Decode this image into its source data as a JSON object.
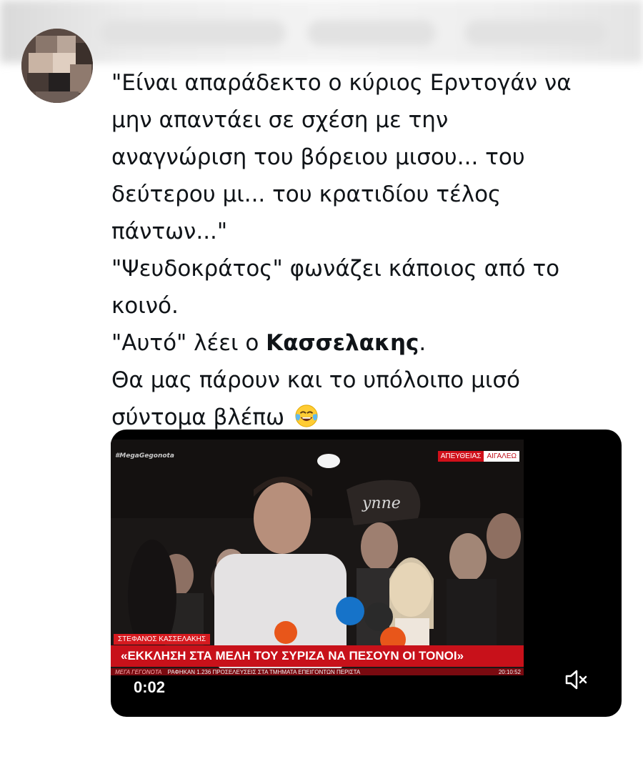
{
  "tweet": {
    "lines": [
      "\"Είναι απαράδεκτο ο κύριος Ερντογάν να",
      "μην απαντάει σε σχέση με την",
      "αναγνώριση του βόρειου μισου... του",
      "δεύτερου μι... του κρατιδίου τέλος",
      "πάντων...\"",
      "\"Ψευδοκράτος\" φωνάζει κάποιος από το",
      "κοινό."
    ],
    "line8_prefix": "\"Αυτό\" λέει ο ",
    "line8_bold": "Κασσελακης",
    "line8_suffix": ".",
    "line9": "Θα μας πάρουν και το υπόλοιπο μισό",
    "line10": "σύντομα βλέπω",
    "emoji": "face-with-tears-of-joy-icon"
  },
  "video": {
    "channel_logo": "#MegaGegonota",
    "live_label": "ΑΠΕΥΘΕΙΑΣ",
    "live_location": "ΑΙΓΑΛΕΩ",
    "name_strip": "ΣΤΕΦΑΝΟΣ ΚΑΣΣΕΛΑΚΗΣ",
    "headline": "«ΕΚΚΛΗΣΗ ΣΤΑ ΜΕΛΗ ΤΟΥ ΣΥΡΙΖΑ ΝΑ ΠΕΣΟΥΝ ΟΙ ΤΟΝΟΙ»",
    "ticker_brand": "ΜΕΓΑ ΓΕΓΟΝΟΤΑ",
    "ticker_text": "ΡΑΦΗΚΑΝ 1.236 ΠΡΟΣΕΛΕΥΣΕΙΣ ΣΤΑ ΤΜΗΜΑΤΑ ΕΠΕΙΓΟΝΤΩΝ ΠΕΡΙΣΤΑ",
    "ticker_clock": "20:10:52",
    "timestamp": "0:02",
    "mute_icon": "speaker-muted-icon"
  },
  "colors": {
    "text": "#101418",
    "news_red": "#c8111a",
    "video_bg": "#000000"
  }
}
